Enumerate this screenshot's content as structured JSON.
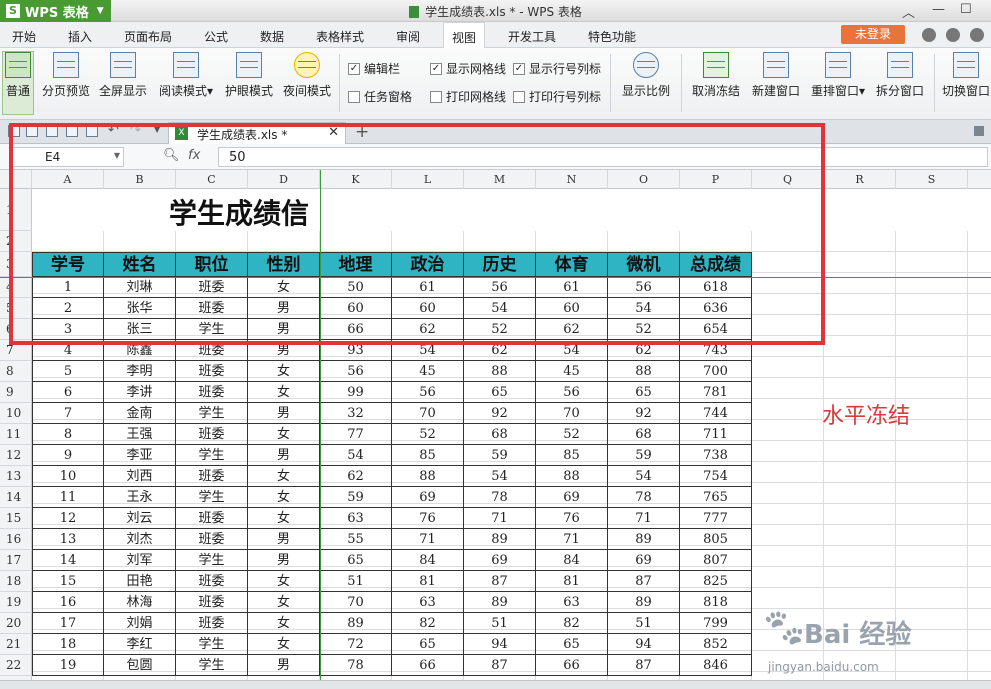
{
  "window": {
    "app_name": "WPS 表格",
    "title": "学生成绩表.xls * - WPS 表格",
    "app_logo": "S"
  },
  "menu": {
    "items": [
      "开始",
      "插入",
      "页面布局",
      "公式",
      "数据",
      "表格样式",
      "审阅",
      "视图",
      "开发工具",
      "特色功能"
    ],
    "active": "视图",
    "login_label": "未登录"
  },
  "ribbon": {
    "view_buttons": [
      "普通",
      "分页预览",
      "全屏显示",
      "阅读模式",
      "护眼模式",
      "夜间模式"
    ],
    "view_arrow": "▾",
    "checkboxes": [
      {
        "label": "编辑栏",
        "checked": true
      },
      {
        "label": "任务窗格",
        "checked": false
      },
      {
        "label": "显示网格线",
        "checked": true
      },
      {
        "label": "打印网格线",
        "checked": false
      },
      {
        "label": "显示行号列标",
        "checked": true
      },
      {
        "label": "打印行号列标",
        "checked": false
      }
    ],
    "window_buttons": [
      "显示比例",
      "取消冻结",
      "新建窗口",
      "重排窗口",
      "拆分窗口",
      "切换窗口"
    ]
  },
  "tabstrip": {
    "doc_tab": "学生成绩表.xls *",
    "new_tab": "+"
  },
  "formula_bar": {
    "name_box": "E4",
    "fx_label": "fx",
    "value": "50"
  },
  "grid": {
    "columns": [
      "A",
      "B",
      "C",
      "D",
      "K",
      "L",
      "M",
      "N",
      "O",
      "P",
      "Q",
      "R",
      "S"
    ],
    "row_numbers": [
      "1",
      "2",
      "3",
      "4",
      "5",
      "6",
      "7",
      "8",
      "9",
      "10",
      "11",
      "12",
      "13",
      "14",
      "15",
      "16",
      "17",
      "18",
      "19",
      "20",
      "21",
      "22"
    ],
    "sheet_title": "学生成绩信",
    "headers": [
      "学号",
      "姓名",
      "职位",
      "性别",
      "地理",
      "政治",
      "历史",
      "体育",
      "微机",
      "总成绩"
    ],
    "rows": [
      [
        "1",
        "刘琳",
        "班委",
        "女",
        "50",
        "61",
        "56",
        "61",
        "56",
        "618"
      ],
      [
        "2",
        "张华",
        "班委",
        "男",
        "60",
        "60",
        "54",
        "60",
        "54",
        "636"
      ],
      [
        "3",
        "张三",
        "学生",
        "男",
        "66",
        "62",
        "52",
        "62",
        "52",
        "654"
      ],
      [
        "4",
        "陈鑫",
        "班委",
        "男",
        "93",
        "54",
        "62",
        "54",
        "62",
        "743"
      ],
      [
        "5",
        "李明",
        "班委",
        "女",
        "56",
        "45",
        "88",
        "45",
        "88",
        "700"
      ],
      [
        "6",
        "李讲",
        "班委",
        "女",
        "99",
        "56",
        "65",
        "56",
        "65",
        "781"
      ],
      [
        "7",
        "金南",
        "学生",
        "男",
        "32",
        "70",
        "92",
        "70",
        "92",
        "744"
      ],
      [
        "8",
        "王强",
        "班委",
        "女",
        "77",
        "52",
        "68",
        "52",
        "68",
        "711"
      ],
      [
        "9",
        "李亚",
        "学生",
        "男",
        "54",
        "85",
        "59",
        "85",
        "59",
        "738"
      ],
      [
        "10",
        "刘西",
        "班委",
        "女",
        "62",
        "88",
        "54",
        "88",
        "54",
        "754"
      ],
      [
        "11",
        "王永",
        "学生",
        "女",
        "59",
        "69",
        "78",
        "69",
        "78",
        "765"
      ],
      [
        "12",
        "刘云",
        "班委",
        "女",
        "63",
        "76",
        "71",
        "76",
        "71",
        "777"
      ],
      [
        "13",
        "刘杰",
        "班委",
        "男",
        "55",
        "71",
        "89",
        "71",
        "89",
        "805"
      ],
      [
        "14",
        "刘军",
        "学生",
        "男",
        "65",
        "84",
        "69",
        "84",
        "69",
        "807"
      ],
      [
        "15",
        "田艳",
        "班委",
        "女",
        "51",
        "81",
        "87",
        "81",
        "87",
        "825"
      ],
      [
        "16",
        "林海",
        "班委",
        "女",
        "70",
        "63",
        "89",
        "63",
        "89",
        "818"
      ],
      [
        "17",
        "刘娟",
        "班委",
        "女",
        "89",
        "82",
        "51",
        "82",
        "51",
        "799"
      ],
      [
        "18",
        "李红",
        "学生",
        "女",
        "72",
        "65",
        "94",
        "65",
        "94",
        "852"
      ],
      [
        "19",
        "包圆",
        "学生",
        "男",
        "78",
        "66",
        "87",
        "66",
        "87",
        "846"
      ]
    ]
  },
  "annotation": "水平冻结",
  "watermark": {
    "brand": "Bai 经验",
    "url": "jingyan.baidu.com"
  },
  "colors": {
    "accent_green": "#4a9a33",
    "header_teal": "#2fb4c4",
    "highlight_red": "#e0343a",
    "freeze_line": "#3c9a3c",
    "login_orange": "#e8743b"
  }
}
